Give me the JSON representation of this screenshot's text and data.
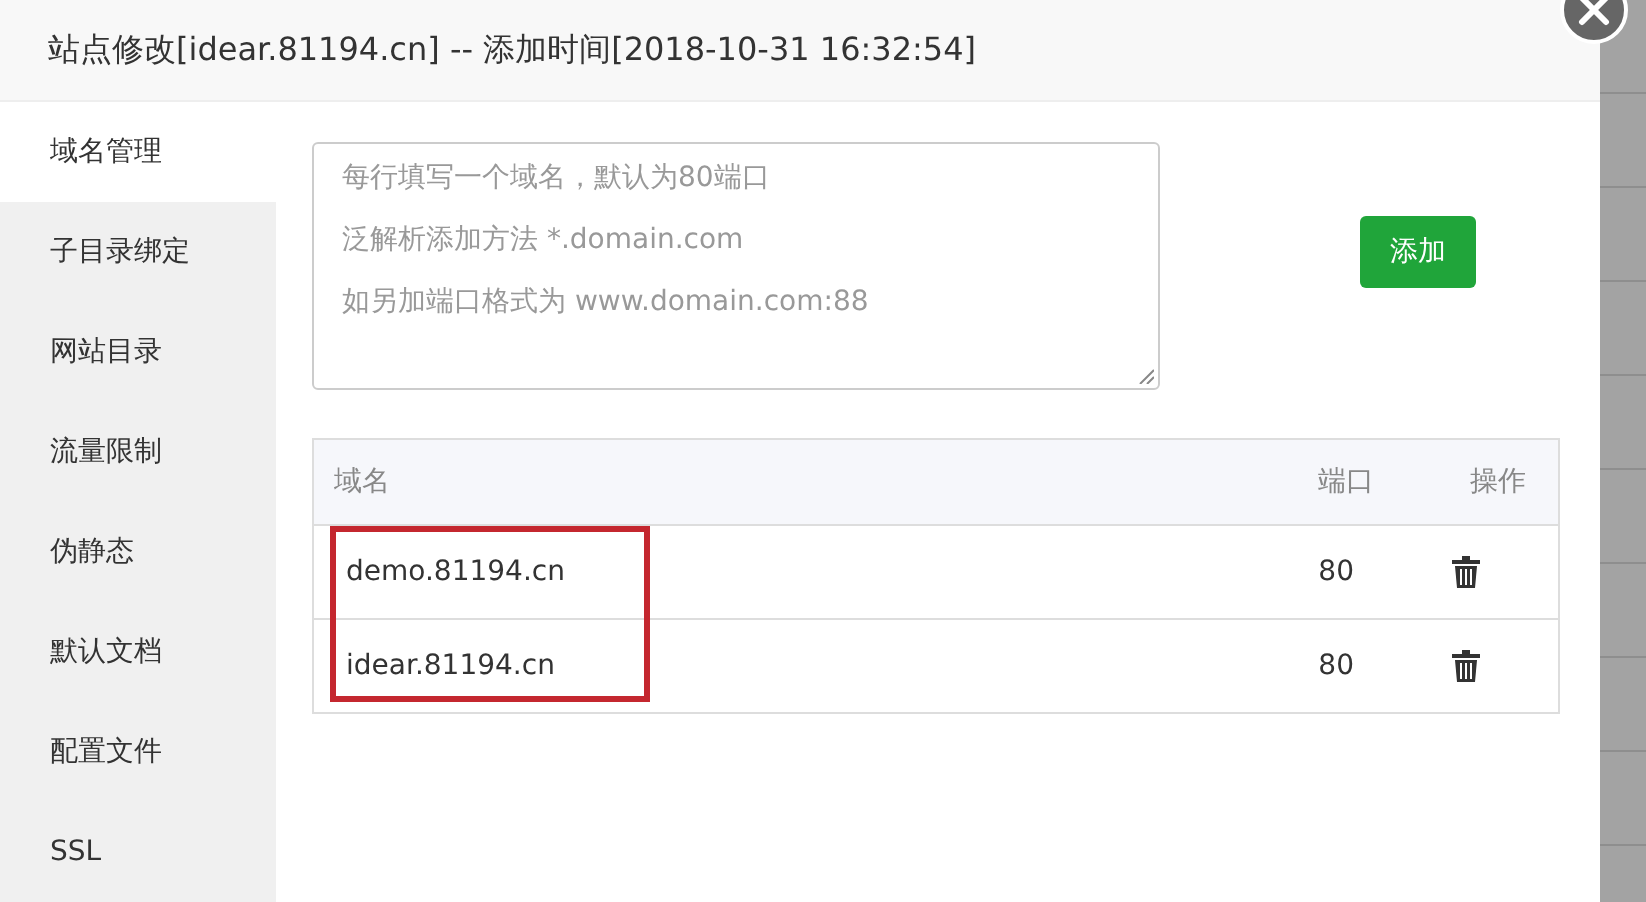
{
  "window": {
    "title": "站点修改[idear.81194.cn] -- 添加时间[2018-10-31 16:32:54]"
  },
  "sidebar": {
    "items": [
      {
        "label": "域名管理",
        "selected": true
      },
      {
        "label": "子目录绑定",
        "selected": false
      },
      {
        "label": "网站目录",
        "selected": false
      },
      {
        "label": "流量限制",
        "selected": false
      },
      {
        "label": "伪静态",
        "selected": false
      },
      {
        "label": "默认文档",
        "selected": false
      },
      {
        "label": "配置文件",
        "selected": false
      },
      {
        "label": "SSL",
        "selected": false
      }
    ]
  },
  "domain_input": {
    "placeholder": [
      "每行填写一个域名，默认为80端口",
      "泛解析添加方法 *.domain.com",
      "如另加端口格式为 www.domain.com:88"
    ]
  },
  "add_button": "添加",
  "table": {
    "columns": [
      "域名",
      "端口",
      "操作"
    ],
    "rows": [
      {
        "domain": "demo.81194.cn",
        "port": "80",
        "highlighted": true
      },
      {
        "domain": "idear.81194.cn",
        "port": "80",
        "highlighted": true
      }
    ]
  }
}
